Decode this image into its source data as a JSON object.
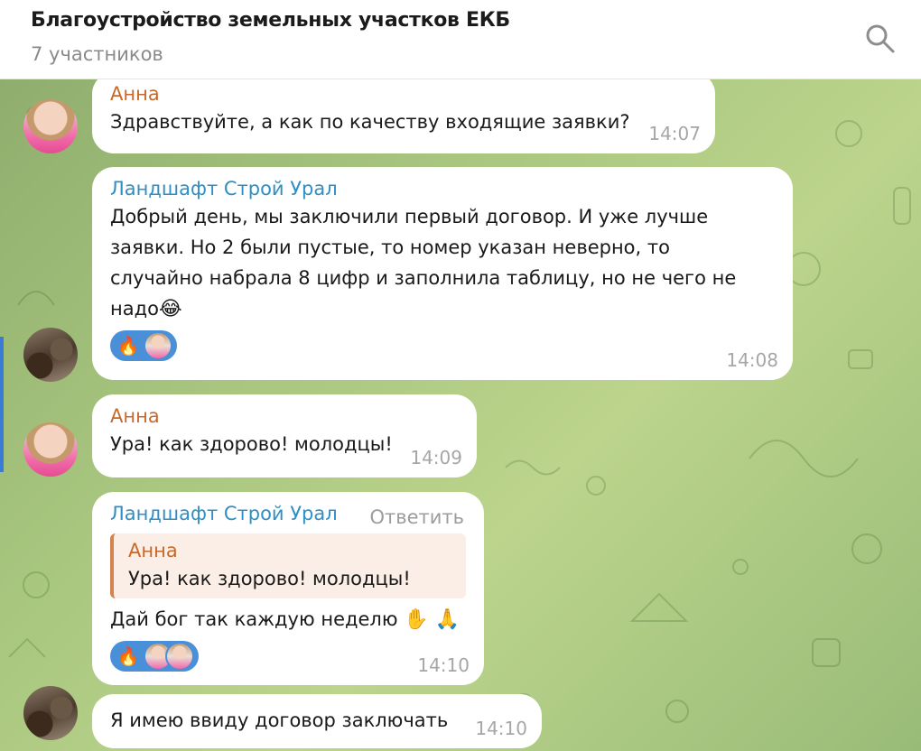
{
  "header": {
    "title": "Благоустройство земельных участков ЕКБ",
    "subtitle": "7 участников"
  },
  "messages": [
    {
      "sender": "Анна",
      "text": "Здравствуйте, а как по качеству входящие заявки?",
      "time": "14:07"
    },
    {
      "sender": "Ландшафт Строй Урал",
      "lines": [
        "Добрый день, мы заключили первый договор. И уже лучше",
        "заявки. Но 2 были пустые, то номер указан неверно, то",
        "случайно набрала 8 цифр и заполнила таблицу, но не чего не",
        "надо"
      ],
      "emoji": "😂",
      "reaction": "🔥",
      "time": "14:08"
    },
    {
      "sender": "Анна",
      "text": "Ура! как здорово! молодцы!",
      "time": "14:09"
    },
    {
      "sender": "Ландшафт Строй Урал",
      "reply_label": "Ответить",
      "quote": {
        "name": "Анна",
        "text": "Ура! как здорово! молодцы!"
      },
      "text": "Дай бог так каждую неделю",
      "emoji": "✋ 🙏",
      "reaction": "🔥",
      "time": "14:10"
    },
    {
      "text": "Я имею ввиду договор заключать",
      "time": "14:10"
    }
  ],
  "colors": {
    "anna": "#c8692c",
    "land": "#2f8fc5",
    "reaction_bg": "#4a90d9"
  },
  "icons": {
    "search": "search-icon"
  }
}
